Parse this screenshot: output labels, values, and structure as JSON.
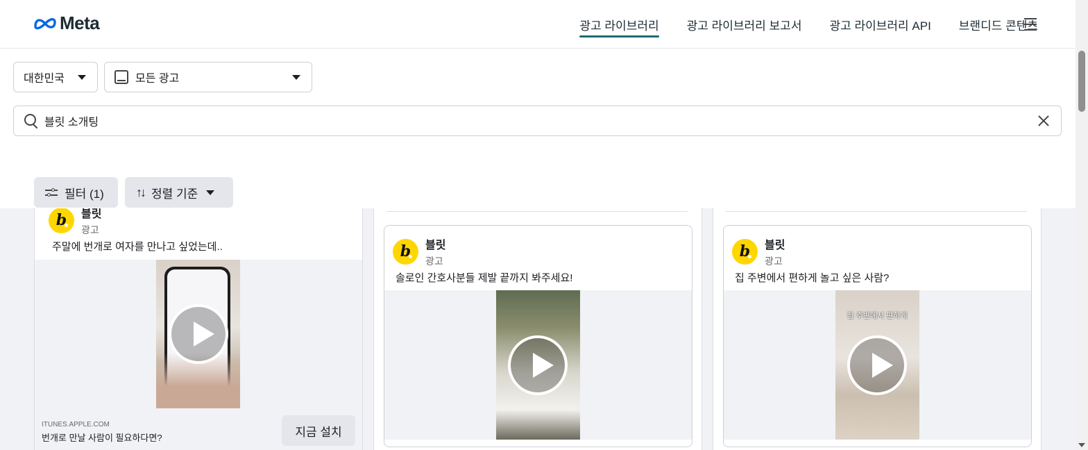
{
  "brand": {
    "logo_text": "Meta"
  },
  "nav": {
    "links": [
      "광고 라이브러리",
      "광고 라이브러리 보고서",
      "광고 라이브러리 API",
      "브랜디드 콘텐츠"
    ],
    "active_color": "#1b6b74"
  },
  "controls": {
    "country": "대한민국",
    "ad_category": "모든 광고",
    "search_value": "블릿 소개팅"
  },
  "filters": {
    "filter_label": "필터 (1)",
    "sort_label": "정렬 기준"
  },
  "ads": [
    {
      "advertiser": "블릿",
      "type_label": "광고",
      "text": "주말에 번개로 여자를 만나고 싶었는데..",
      "cta_domain": "ITUNES.APPLE.COM",
      "cta_caption": "번개로 만날 사람이 필요하다면?",
      "cta_button": "지금 설치"
    },
    {
      "advertiser": "블릿",
      "type_label": "광고",
      "text": "솔로인 간호사분들 제발 끝까지 봐주세요!"
    },
    {
      "advertiser": "블릿",
      "type_label": "광고",
      "text": "집 주변에서 편하게 놀고 싶은 사람?",
      "video_overlay": "집 주변에서 편하게"
    }
  ],
  "avatar_color": "#ffd600",
  "icons": {
    "logo": "meta-infinity-icon",
    "menu": "hamburger-menu-icon",
    "device": "tablet-icon",
    "search": "search-icon",
    "clear": "close-icon",
    "filter": "sliders-icon",
    "sort": "sort-arrows-icon",
    "play": "play-icon"
  }
}
